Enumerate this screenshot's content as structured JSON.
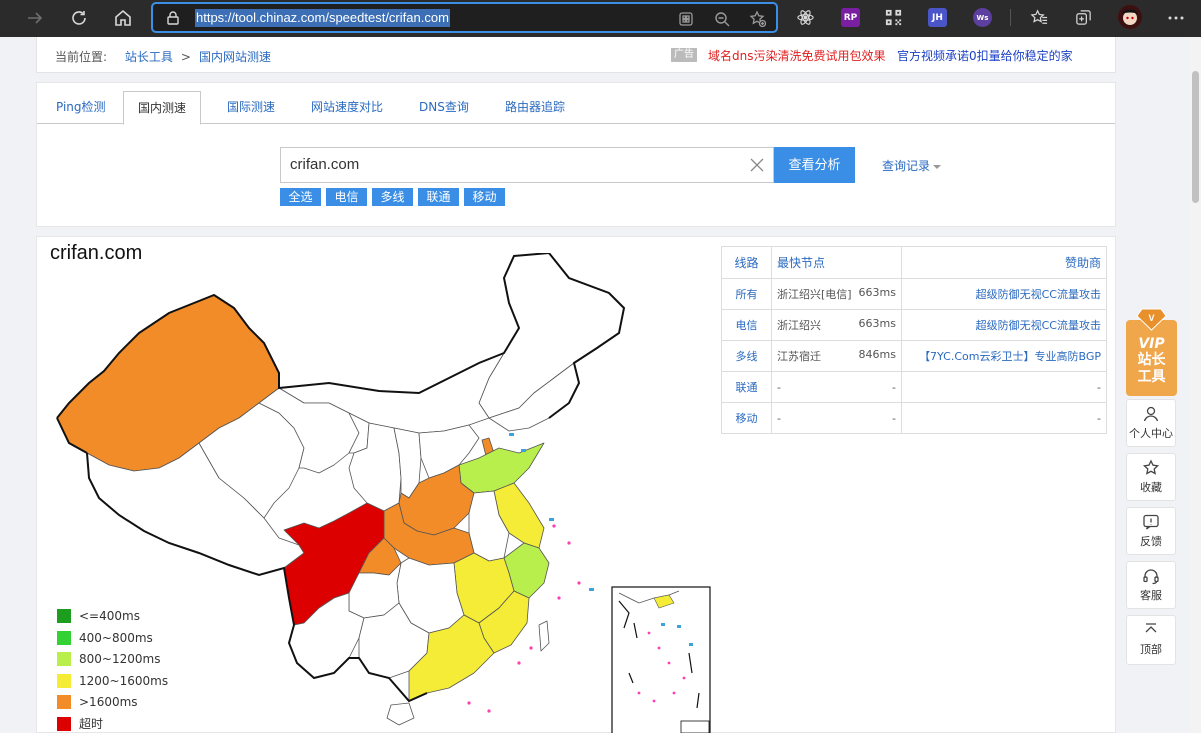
{
  "browser": {
    "url": "https://tool.chinaz.com/speedtest/crifan.com",
    "extensions": [
      {
        "name": "react-devtools-icon",
        "label": ""
      },
      {
        "name": "rp-extension-icon",
        "label": "RP"
      },
      {
        "name": "qr-code-icon",
        "label": ""
      },
      {
        "name": "jh-extension-icon",
        "label": "JH"
      },
      {
        "name": "ws-extension-icon",
        "label": "Ws"
      }
    ]
  },
  "breadcrumb": {
    "prefix": "当前位置:",
    "home": "站长工具",
    "separator": ">",
    "current": "国内网站测速"
  },
  "ads": {
    "tag": "广告",
    "ad1": "域名dns污染清洗免费试用包效果",
    "ad2": "官方视频承诺0扣量给你稳定的家"
  },
  "tabs": [
    {
      "label": "Ping检测"
    },
    {
      "label": "国内测速"
    },
    {
      "label": "国际测速"
    },
    {
      "label": "网站速度对比"
    },
    {
      "label": "DNS查询"
    },
    {
      "label": "路由器追踪"
    }
  ],
  "search": {
    "value": "crifan.com",
    "button": "查看分析",
    "history": "查询记录"
  },
  "chips": [
    "全选",
    "电信",
    "多线",
    "联通",
    "移动"
  ],
  "result": {
    "title": "crifan.com",
    "table": {
      "headers": [
        "线路",
        "最快节点",
        "赞助商"
      ],
      "rows": [
        {
          "line": "所有",
          "node": "浙江绍兴[电信]",
          "ms": "663ms",
          "sponsor": "超级防御无视CC流量攻击"
        },
        {
          "line": "电信",
          "node": "浙江绍兴",
          "ms": "663ms",
          "sponsor": "超级防御无视CC流量攻击"
        },
        {
          "line": "多线",
          "node": "江苏宿迁",
          "ms": "846ms",
          "sponsor": "【7YC.Com云彩卫士】专业高防BGP"
        },
        {
          "line": "联通",
          "node": "-",
          "ms": "-",
          "sponsor": "-"
        },
        {
          "line": "移动",
          "node": "-",
          "ms": "-",
          "sponsor": "-"
        }
      ]
    },
    "legend": [
      {
        "label": "<=400ms",
        "color": "#1e9e1e"
      },
      {
        "label": "400~800ms",
        "color": "#34d134"
      },
      {
        "label": "800~1200ms",
        "color": "#b8ef4d"
      },
      {
        "label": "1200~1600ms",
        "color": "#f4ec36"
      },
      {
        "label": ">1600ms",
        "color": "#f28c28"
      },
      {
        "label": "超时",
        "color": "#dd0000"
      }
    ]
  },
  "side": {
    "vip_top": "VIP",
    "vip_bottom": "站长工具",
    "buttons": [
      {
        "label": "个人中心",
        "name": "user-center-button"
      },
      {
        "label": "收藏",
        "name": "favorite-button"
      },
      {
        "label": "反馈",
        "name": "feedback-button"
      },
      {
        "label": "客服",
        "name": "customer-service-button"
      },
      {
        "label": "顶部",
        "name": "back-to-top-button"
      }
    ]
  }
}
